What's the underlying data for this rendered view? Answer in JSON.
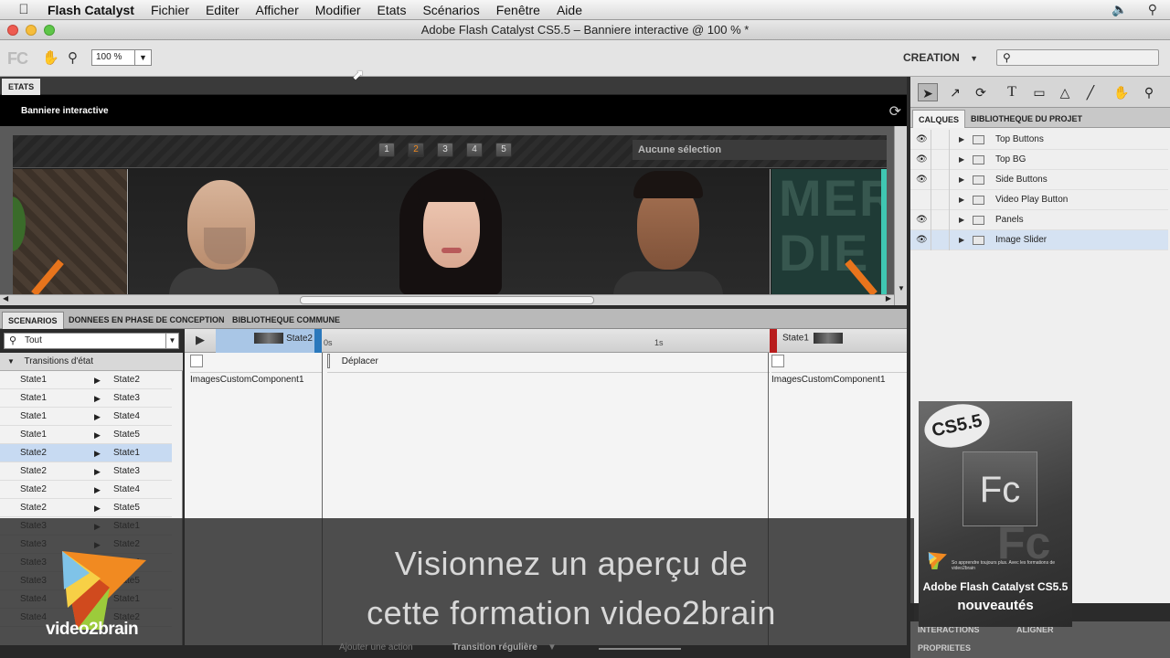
{
  "menubar": {
    "app": "Flash Catalyst",
    "items": [
      "Fichier",
      "Editer",
      "Afficher",
      "Modifier",
      "Etats",
      "Scénarios",
      "Fenêtre",
      "Aide"
    ]
  },
  "window": {
    "title": "Adobe Flash Catalyst CS5.5 – Banniere interactive @ 100 % *"
  },
  "toolbar": {
    "logo": "FC",
    "zoom": "100 %",
    "workspace": "CREATION"
  },
  "states_panel": {
    "tab": "ETATS",
    "project_name": "Banniere interactive",
    "pagers": [
      "1",
      "2",
      "3",
      "4",
      "5"
    ],
    "no_selection": "Aucune sélection"
  },
  "layers_panel": {
    "tabs": [
      "CALQUES",
      "BIBLIOTHEQUE DU PROJET"
    ],
    "layers": [
      {
        "name": "Top Buttons",
        "visible": true
      },
      {
        "name": "Top BG",
        "visible": true
      },
      {
        "name": "Side Buttons",
        "visible": true
      },
      {
        "name": "Video Play Button",
        "visible": false
      },
      {
        "name": "Panels",
        "visible": true
      },
      {
        "name": "Image Slider",
        "visible": true
      }
    ]
  },
  "scenarios_panel": {
    "tabs": [
      "SCENARIOS",
      "DONNEES EN PHASE DE CONCEPTION",
      "BIBLIOTHEQUE COMMUNE"
    ],
    "filter": "Tout",
    "header": "Transitions d'état",
    "transitions": [
      {
        "from": "State1",
        "to": "State2"
      },
      {
        "from": "State1",
        "to": "State3"
      },
      {
        "from": "State1",
        "to": "State4"
      },
      {
        "from": "State1",
        "to": "State5"
      },
      {
        "from": "State2",
        "to": "State1"
      },
      {
        "from": "State2",
        "to": "State3"
      },
      {
        "from": "State2",
        "to": "State4"
      },
      {
        "from": "State2",
        "to": "State5"
      },
      {
        "from": "State3",
        "to": "State1"
      },
      {
        "from": "State3",
        "to": "State2"
      },
      {
        "from": "State3",
        "to": "State4"
      },
      {
        "from": "State3",
        "to": "State5"
      },
      {
        "from": "State4",
        "to": "State1"
      },
      {
        "from": "State4",
        "to": "State2"
      }
    ],
    "selected_index": 4
  },
  "timeline": {
    "start_state": "State2",
    "end_state": "State1",
    "ruler": [
      "0s",
      "1s"
    ],
    "component_left": "ImagesCustomComponent1",
    "action": "Déplacer",
    "component_right": "ImagesCustomComponent1",
    "bottom_add": "Ajouter une action",
    "bottom_smooth": "Transition régulière"
  },
  "overlay": {
    "line1": "Visionnez un aperçu de",
    "line2": "cette formation video2brain",
    "brand": "video2brain"
  },
  "right_bottom": {
    "interactions": "INTERACTIONS",
    "align": "ALIGNER",
    "props": "PROPRIETES"
  },
  "boxart": {
    "badge": "CS5.5",
    "icon": "Fc",
    "tagline": "So apprendre toujours plus. Avec les formations de video2brain",
    "product": "Adobe Flash Catalyst CS5.5",
    "subtitle": "nouveautés"
  }
}
